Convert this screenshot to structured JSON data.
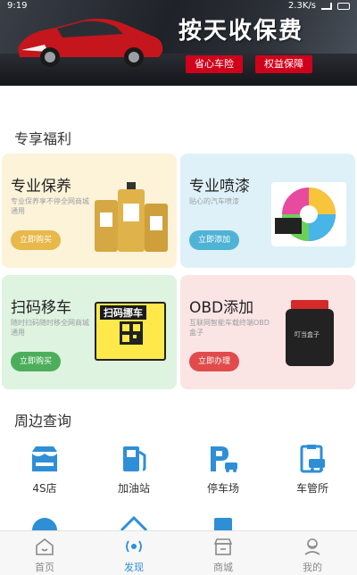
{
  "status_bar": {
    "time": "9:19",
    "speed": "2.3K/s"
  },
  "banner": {
    "headline": "按天收保费",
    "tag_left": "省心车险",
    "tag_right": "权益保障"
  },
  "welfare": {
    "title": "专享福利",
    "cards": [
      {
        "title": "专业保养",
        "desc": "专业保养享不停全网商城通用",
        "button": "立即购买",
        "accent": "#e8b84a"
      },
      {
        "title": "专业喷漆",
        "desc": "贴心的汽车喷漆",
        "button": "立即添加",
        "accent": "#4fb3d6"
      },
      {
        "title": "扫码移车",
        "desc": "随时扫码随时移全网商城通用",
        "button": "立即购买",
        "accent": "#4cae5b",
        "qr_text": "扫码挪车"
      },
      {
        "title": "OBD添加",
        "desc": "互联网智能车载终端OBD盒子",
        "button": "立即办理",
        "accent": "#e14b4b",
        "device_text": "叮当盒子"
      }
    ]
  },
  "nearby": {
    "title": "周边查询",
    "items": [
      {
        "label": "4S店",
        "icon": "shop-icon"
      },
      {
        "label": "加油站",
        "icon": "fuel-pump-icon"
      },
      {
        "label": "停车场",
        "icon": "parking-icon"
      },
      {
        "label": "车管所",
        "icon": "vehicle-office-icon"
      }
    ]
  },
  "tabbar": {
    "items": [
      {
        "label": "首页",
        "icon": "home-icon",
        "active": false
      },
      {
        "label": "发现",
        "icon": "discover-icon",
        "active": true
      },
      {
        "label": "商城",
        "icon": "store-icon",
        "active": false
      },
      {
        "label": "我的",
        "icon": "profile-icon",
        "active": false
      }
    ]
  },
  "colors": {
    "primary": "#2e8fd6",
    "inactive": "#8a8a8a",
    "banner_red": "#d0021b"
  }
}
